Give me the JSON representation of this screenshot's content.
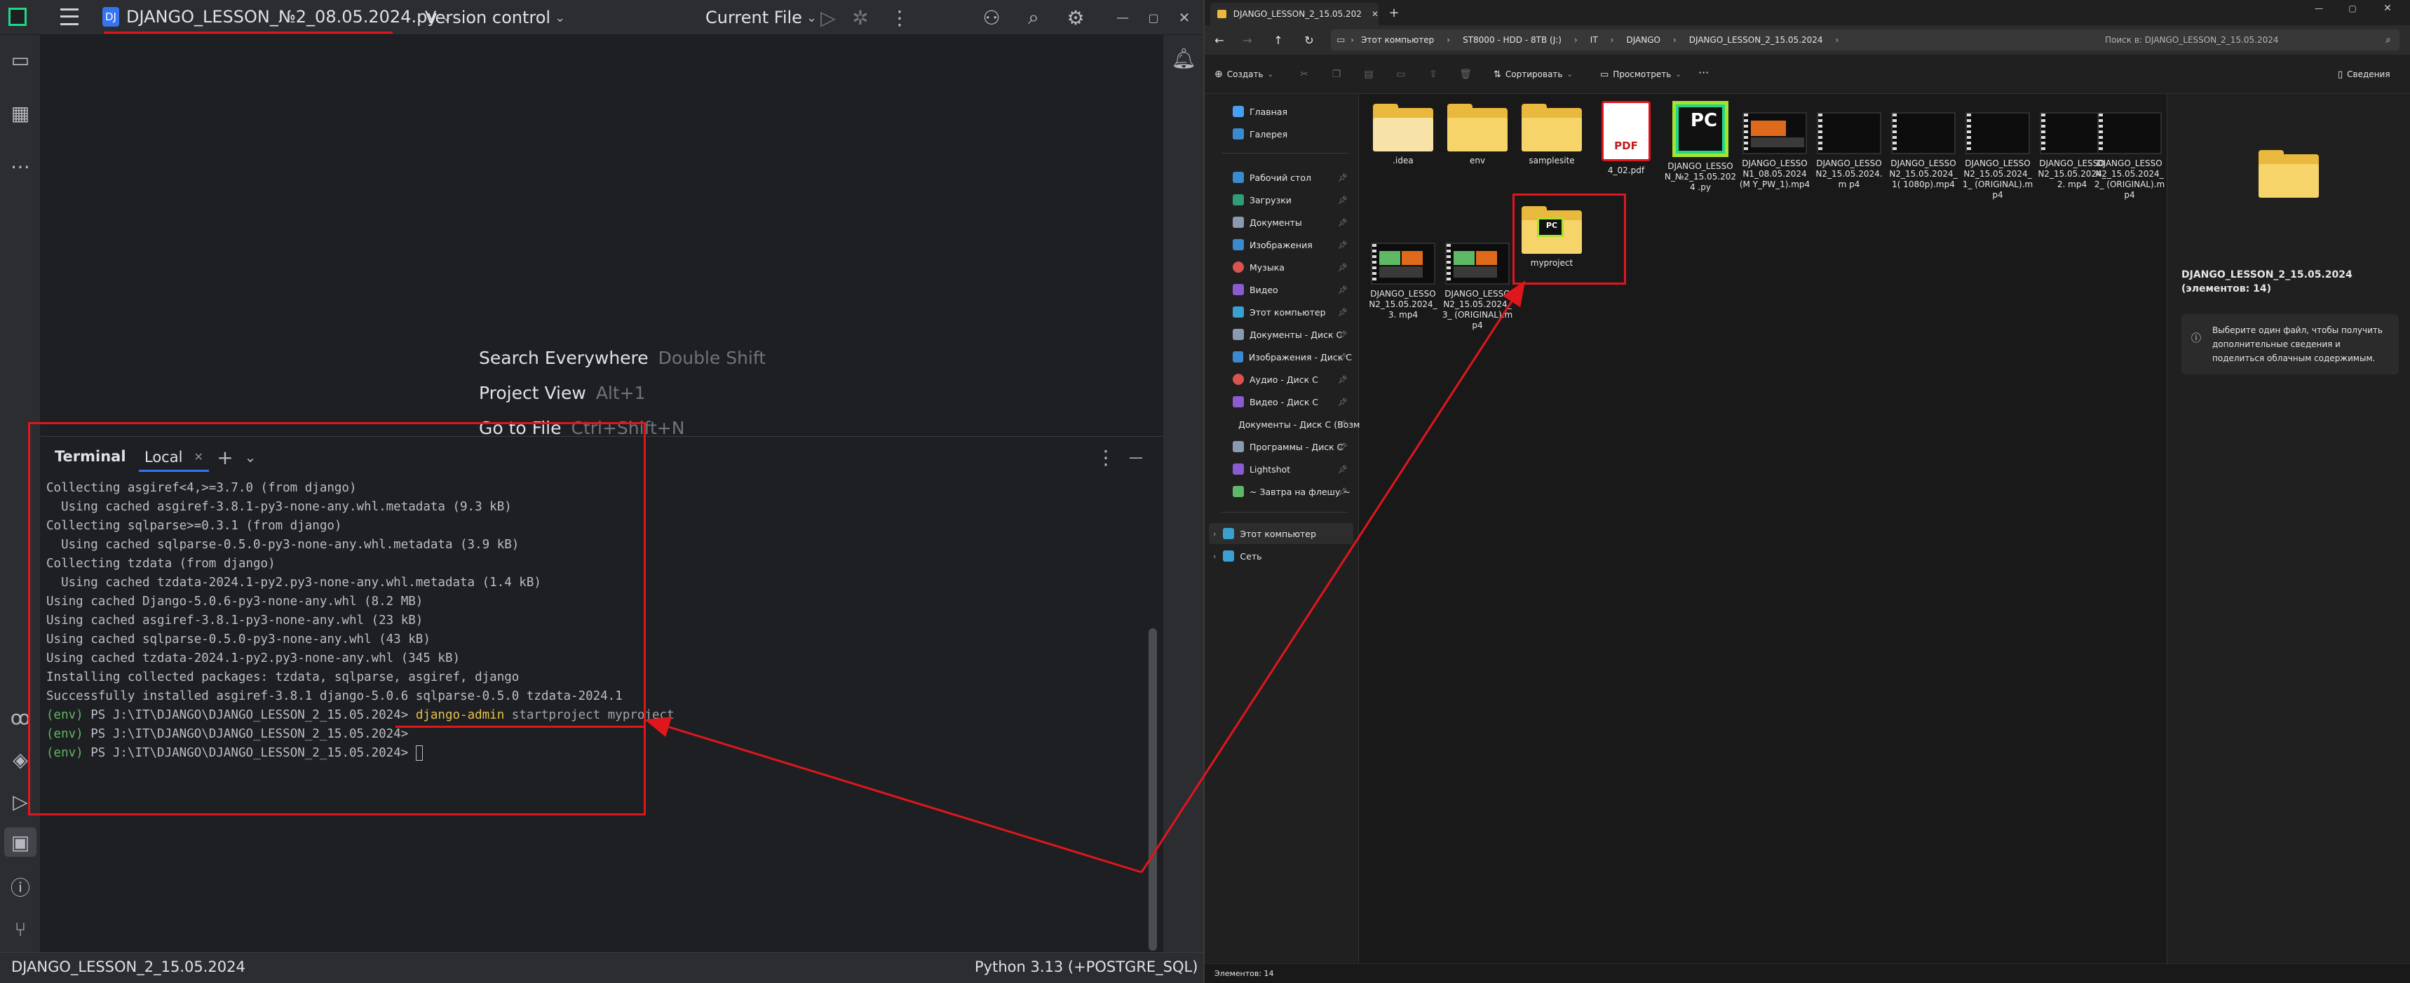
{
  "ide": {
    "project_name": "DJANGO_LESSON_№2_08.05.2024.py",
    "project_badge": "DJ",
    "vcs": "Version control",
    "run_config": "Current File",
    "hints": [
      {
        "action": "Search Everywhere",
        "key": "Double Shift"
      },
      {
        "action": "Project View",
        "key": "Alt+1"
      },
      {
        "action": "Go to File",
        "key": "Ctrl+Shift+N"
      }
    ],
    "terminal": {
      "title": "Terminal",
      "tab": "Local",
      "lines": [
        "Collecting asgiref<4,>=3.7.0 (from django)",
        "  Using cached asgiref-3.8.1-py3-none-any.whl.metadata (9.3 kB)",
        "Collecting sqlparse>=0.3.1 (from django)",
        "  Using cached sqlparse-0.5.0-py3-none-any.whl.metadata (3.9 kB)",
        "Collecting tzdata (from django)",
        "  Using cached tzdata-2024.1-py2.py3-none-any.whl.metadata (1.4 kB)",
        "Using cached Django-5.0.6-py3-none-any.whl (8.2 MB)",
        "Using cached asgiref-3.8.1-py3-none-any.whl (23 kB)",
        "Using cached sqlparse-0.5.0-py3-none-any.whl (43 kB)",
        "Using cached tzdata-2024.1-py2.py3-none-any.whl (345 kB)",
        "Installing collected packages: tzdata, sqlparse, asgiref, django",
        "Successfully installed asgiref-3.8.1 django-5.0.6 sqlparse-0.5.0 tzdata-2024.1"
      ],
      "prompt_env": "(env)",
      "prompt_path": " PS J:\\IT\\DJANGO\\DJANGO_LESSON_2_15.05.2024> ",
      "command": "django-admin",
      "command_args": " startproject myproject"
    },
    "status_left": "DJANGO_LESSON_2_15.05.2024",
    "status_right": "Python 3.13 (+POSTGRE_SQL)"
  },
  "explorer": {
    "tab_title": "DJANGO_LESSON_2_15.05.202",
    "breadcrumb": [
      "Этот компьютер",
      "ST8000 - HDD - 8ТВ (J:)",
      "IT",
      "DJANGO",
      "DJANGO_LESSON_2_15.05.2024"
    ],
    "search_placeholder": "Поиск в: DJANGO_LESSON_2_15.05.2024",
    "toolbar": {
      "create": "Создать",
      "sort": "Сортировать",
      "view": "Просмотреть",
      "more": "···",
      "details": "Сведения"
    },
    "nav_top": [
      "Главная",
      "Галерея"
    ],
    "nav_quick": [
      "Рабочий стол",
      "Загрузки",
      "Документы",
      "Изображения",
      "Музыка",
      "Видео",
      "Этот компьютер",
      "Документы - Диск C",
      "Изображения - Диск C",
      "Аудио - Диск C",
      "Видео - Диск C",
      "Документы - Диск C (Возм",
      "Программы - Диск C",
      "Lightshot",
      "~ Завтра на флешу ~"
    ],
    "nav_tree": [
      "Этот компьютер",
      "Сеть"
    ],
    "files": [
      {
        "name": ".idea",
        "kind": "folder"
      },
      {
        "name": "env",
        "kind": "folder"
      },
      {
        "name": "samplesite",
        "kind": "folder"
      },
      {
        "name": "4_02.pdf",
        "kind": "pdf"
      },
      {
        "name": "DJANGO_LESSO N_№2_15.05.2024 .py",
        "kind": "pycharm"
      },
      {
        "name": "DJANGO_LESSO N1_08.05.2024(M Y_PW_1).mp4",
        "kind": "video"
      },
      {
        "name": "DJANGO_LESSO N2_15.05.2024.m p4",
        "kind": "video"
      },
      {
        "name": "DJANGO_LESSO N2_15.05.2024_1( 1080p).mp4",
        "kind": "video"
      },
      {
        "name": "DJANGO_LESSO N2_15.05.2024_1_ (ORIGINAL).mp4",
        "kind": "video"
      },
      {
        "name": "DJANGO_LESSO N2_15.05.2024_2. mp4",
        "kind": "video"
      },
      {
        "name": "DJANGO_LESSO N2_15.05.2024_2_ (ORIGINAL).mp4",
        "kind": "video"
      },
      {
        "name": "DJANGO_LESSO N2_15.05.2024_3. mp4",
        "kind": "video"
      },
      {
        "name": "DJANGO_LESSO N2_15.05.2024_3_ (ORIGINAL).mp4",
        "kind": "video"
      },
      {
        "name": "myproject",
        "kind": "folder-pc"
      }
    ],
    "preview_title": "DJANGO_LESSON_2_15.05.2024",
    "preview_count": "(элементов: 14)",
    "preview_info": "Выберите один файл, чтобы получить дополнительные сведения и поделиться облачным содержимым.",
    "status": "Элементов: 14"
  },
  "colors": {
    "annotation": "#e0161d",
    "folder": "#e9b93e",
    "accent": "#5fb865"
  }
}
